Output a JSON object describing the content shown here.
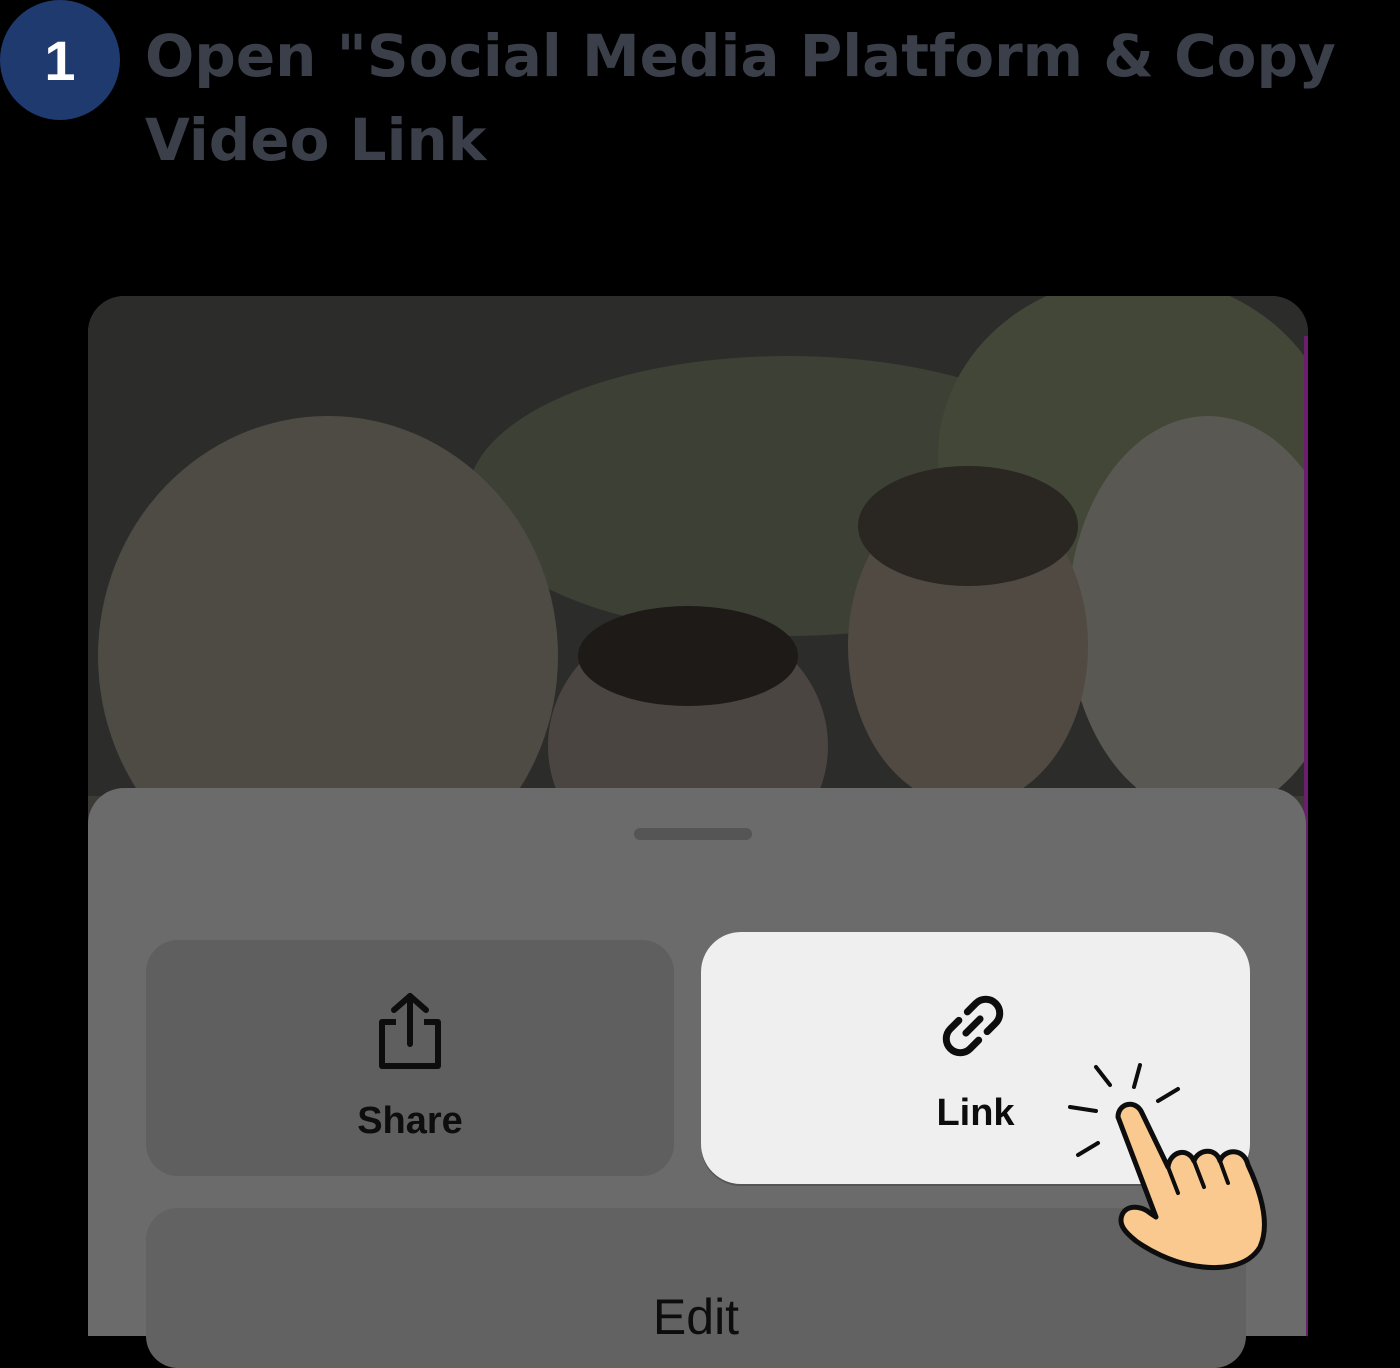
{
  "step": {
    "number": "1",
    "title": "Open \"Social Media Platform & Copy Video Link"
  },
  "sheet": {
    "share_label": "Share",
    "link_label": "Link",
    "edit_label": "Edit"
  },
  "icons": {
    "share": "share-icon",
    "link": "link-icon",
    "pointer": "tap-hand-icon"
  },
  "colors": {
    "badge": "#1f3a6e",
    "sheet": "#6b6b6b",
    "highlight_button": "#efefef",
    "hand": "#f9c98f"
  }
}
